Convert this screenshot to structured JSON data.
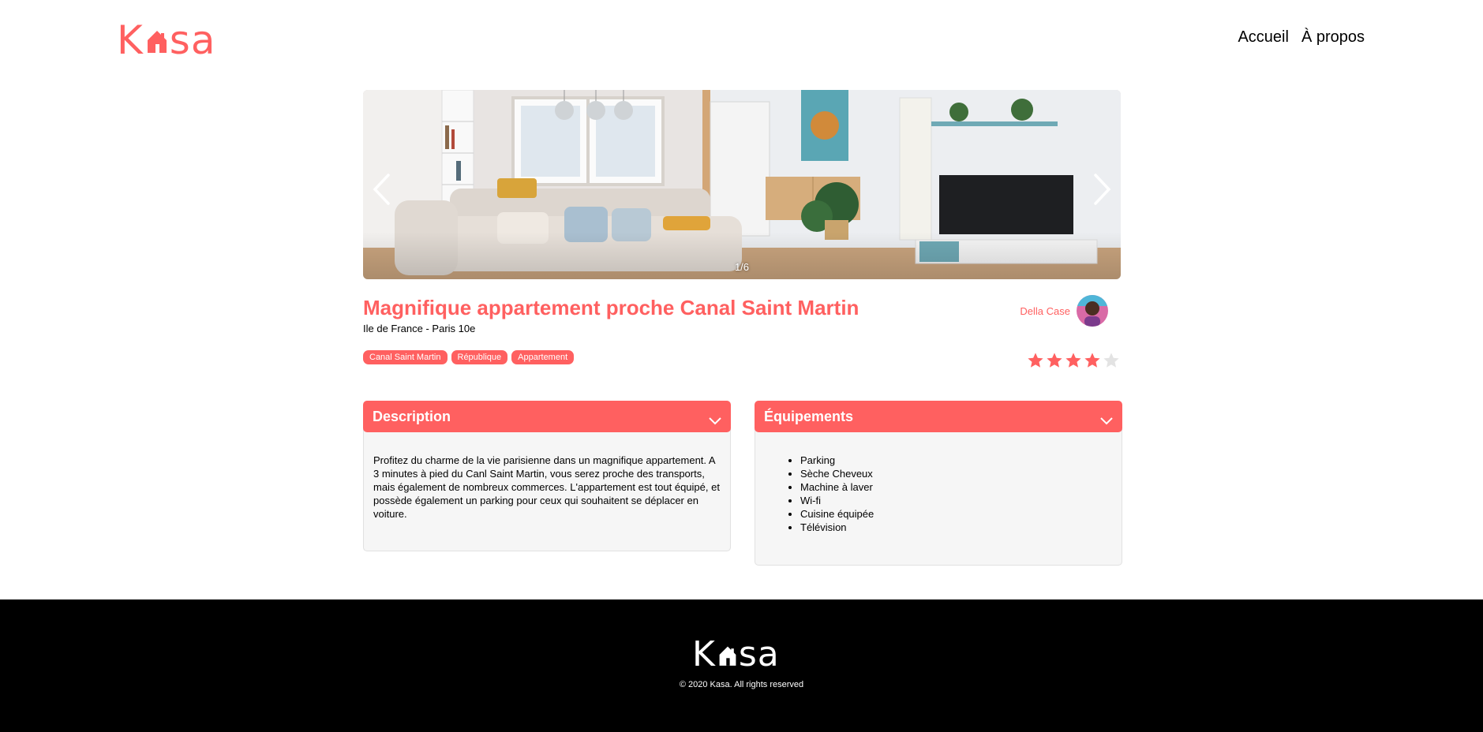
{
  "header": {
    "logo": {
      "first": "K",
      "rest": "sa"
    },
    "nav": [
      {
        "label": "Accueil"
      },
      {
        "label": "À propos"
      }
    ]
  },
  "carousel": {
    "counter": "1/6",
    "prev_icon": "chevron-left-icon",
    "next_icon": "chevron-right-icon"
  },
  "listing": {
    "title": "Magnifique appartement proche Canal Saint Martin",
    "location": "Ile de France - Paris 10e",
    "tags": [
      "Canal Saint Martin",
      "République",
      "Appartement"
    ],
    "host": {
      "name": "Della Case"
    },
    "rating": 4,
    "rating_max": 5
  },
  "description": {
    "title": "Description",
    "text": "Profitez du charme de la vie parisienne dans un magnifique appartement. A 3 minutes à pied du Canl Saint Martin, vous serez proche des transports, mais également de nombreux commerces. L'appartement est tout équipé, et possède également un parking pour ceux qui souhaitent se déplacer en voiture."
  },
  "equipments": {
    "title": "Équipements",
    "items": [
      "Parking",
      "Sèche Cheveux",
      "Machine à laver",
      "Wi-fi",
      "Cuisine équipée",
      "Télévision"
    ]
  },
  "footer": {
    "logo": {
      "first": "K",
      "rest": "sa"
    },
    "copyright": "© 2020 Kasa. All rights reserved"
  },
  "colors": {
    "accent": "#FF6060",
    "panel": "#F6F6F6",
    "star_off": "#E3E3E3",
    "footer_bg": "#000000"
  }
}
